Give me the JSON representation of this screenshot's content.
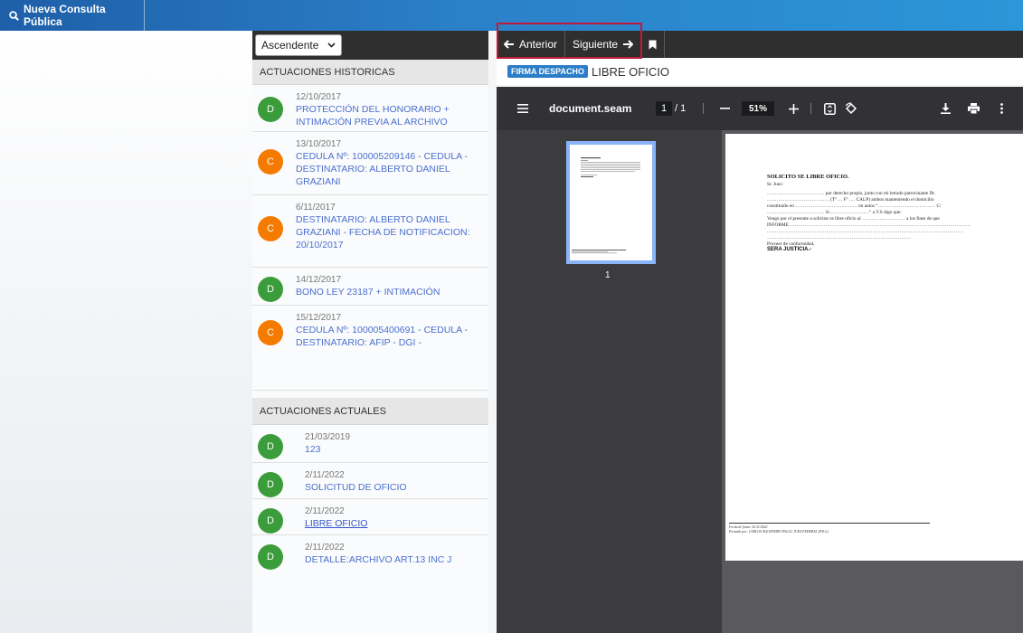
{
  "topbar": {
    "new_query_label": "Nueva Consulta Pública",
    "icon": "search-icon"
  },
  "list": {
    "order_select": {
      "selected": "Ascendente"
    },
    "historic_header": "ACTUACIONES HISTORICAS",
    "historic": [
      {
        "letter": "D",
        "color": "#3a9c3a",
        "date": "12/10/2017",
        "desc": "PROTECCIÓN DEL HONORARIO + INTIMACIÓN PREVIA AL ARCHIVO"
      },
      {
        "letter": "C",
        "color": "#f47a00",
        "date": "13/10/2017",
        "desc": "CEDULA Nº: 100005209146 - CEDULA - DESTINATARIO: ALBERTO DANIEL GRAZIANI"
      },
      {
        "letter": "C",
        "color": "#f47a00",
        "date": "6/11/2017",
        "desc": "DESTINATARIO: ALBERTO DANIEL GRAZIANI - FECHA DE NOTIFICACION: 20/10/2017"
      },
      {
        "letter": "D",
        "color": "#3a9c3a",
        "date": "14/12/2017",
        "desc": "BONO LEY 23187 + INTIMACIÓN"
      },
      {
        "letter": "C",
        "color": "#f47a00",
        "date": "15/12/2017",
        "desc": "CEDULA Nº: 100005400691 - CEDULA - DESTINATARIO: AFIP - DGI -"
      }
    ],
    "current_header": "ACTUACIONES ACTUALES",
    "current": [
      {
        "letter": "D",
        "date": "21/03/2019",
        "desc": "123"
      },
      {
        "letter": "D",
        "date": "2/11/2022",
        "desc": "SOLICITUD DE OFICIO"
      },
      {
        "letter": "D",
        "date": "2/11/2022",
        "desc": "LIBRE OFICIO"
      },
      {
        "letter": "D",
        "date": "2/11/2022",
        "desc": "DETALLE:ARCHIVO ART.13 INC J"
      }
    ]
  },
  "doc_nav": {
    "prev_label": "Anterior",
    "next_label": "Siguiente"
  },
  "doc_badge": {
    "badge": "FIRMA DESPACHO",
    "title": "LIBRE OFICIO"
  },
  "pdf": {
    "filename": "document.seam",
    "page_current": "1",
    "page_total": "/ 1",
    "zoom": "51%",
    "thumb_label": "1",
    "page_text": {
      "title": "SOLICITO SE LIBRE OFICIO.",
      "lines": [
        "Sr. Juez:",
        "……………………………… por derecho propio, junto con mi letrado patrocinante Dr.",
        "………………………………… (Tº … Fº …. CALP) ambos manteniendo el domicilio",
        "constituido en ………………………………… en autos “……………………………… C/",
        "……………………………… S/…………………….” a V.S digo que:",
        "Vengo por el presente a solicitar se libre oficio al ……………………… a los fines de que",
        "INFORME……………………………………………………………………………………………………",
        "……………………………………………………………………………………………………………",
        "………………………………………………………………………………",
        "Proveer de conformidad,"
      ],
      "closing": "SERA JUSTICIA.-",
      "footer_1": "Fecha de firma: 02/11/2022",
      "footer_2": "Firmado por: CARLOS ALEJANDRO FAGGI, JUEZ FEDERAL (P.R.S.)"
    }
  }
}
